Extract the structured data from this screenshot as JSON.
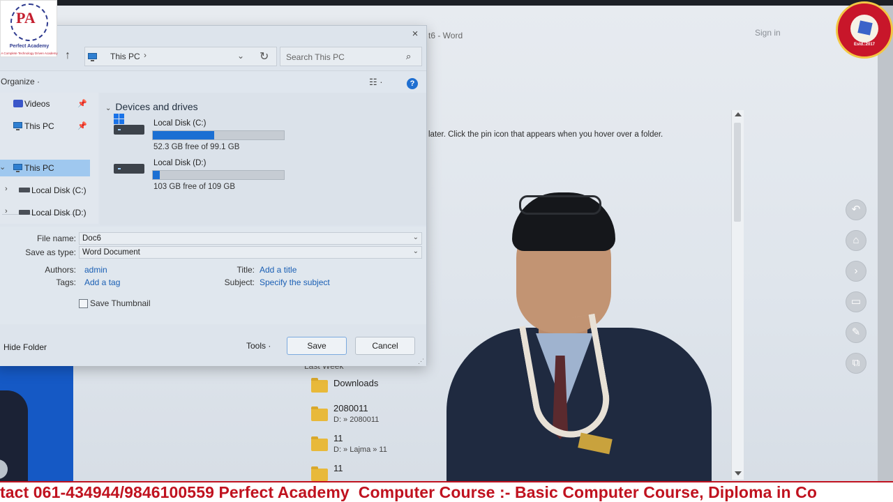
{
  "word": {
    "window_title": "t6 - Word",
    "signin": "Sign in",
    "hint": "later. Click the pin icon that appears when you hover over a folder.",
    "recent_header": "Last Week",
    "recent_items": [
      {
        "name": "Downloads",
        "path": ""
      },
      {
        "name": "2080011",
        "path": "D: » 2080011"
      },
      {
        "name": "11",
        "path": "D: » Lajma » 11"
      },
      {
        "name": "11",
        "path": ""
      }
    ]
  },
  "dialog": {
    "close_glyph": "×",
    "address": {
      "location": "This PC",
      "separator": "›",
      "dropdown_glyph": "⌄",
      "refresh_glyph": "↻",
      "up_glyph": "↑"
    },
    "search_placeholder": "Search This PC",
    "search_glyph": "⌕",
    "organize": "Organize ·",
    "view_glyph": "☷ ·",
    "help_glyph": "?",
    "nav": {
      "quick": [
        {
          "label": "Videos",
          "pin": "📌"
        },
        {
          "label": "This PC",
          "pin": "📌"
        }
      ],
      "tree": [
        {
          "label": "This PC",
          "chevron": "⌄"
        },
        {
          "label": "Local Disk (C:)",
          "chevron": "›"
        },
        {
          "label": "Local Disk (D:)",
          "chevron": "›"
        }
      ]
    },
    "section_title": "Devices and drives",
    "section_chevron": "⌄",
    "drives": [
      {
        "name": "Local Disk (C:)",
        "free_text": "52.3 GB free of 99.1 GB",
        "used_fraction": 0.47
      },
      {
        "name": "Local Disk (D:)",
        "free_text": "103 GB free of 109 GB",
        "used_fraction": 0.055
      }
    ],
    "fields": {
      "file_name_label": "File name:",
      "file_name_value": "Doc6",
      "save_type_label": "Save as type:",
      "save_type_value": "Word Document",
      "dropdown_glyph": "⌄",
      "authors_label": "Authors:",
      "authors_value": "admin",
      "tags_label": "Tags:",
      "tags_value": "Add a tag",
      "title_label": "Title:",
      "title_value": "Add a title",
      "subject_label": "Subject:",
      "subject_value": "Specify the subject",
      "save_thumbnail": "Save Thumbnail"
    },
    "footer": {
      "hide_folder": "Hide Folder",
      "tools": "Tools  ·",
      "save": "Save",
      "cancel": "Cancel"
    }
  },
  "side_tools": [
    {
      "icon": "back-icon",
      "glyph": "↶"
    },
    {
      "icon": "home-icon",
      "glyph": "⌂"
    },
    {
      "icon": "forward-icon",
      "glyph": "›"
    },
    {
      "icon": "briefcase-icon",
      "glyph": "▭"
    },
    {
      "icon": "pen-icon",
      "glyph": "✎"
    },
    {
      "icon": "windows-icon",
      "glyph": "⧉"
    }
  ],
  "logos": {
    "academy_letters": "PA",
    "academy_name": "Perfect Academy",
    "academy_tagline": "A Complete Technology Driven Academy",
    "printing_est": "Estd.:2017"
  },
  "ticker": "tact 061-434944/9846100559 Perfect Academy  Computer Course :- Basic Computer Course, Diploma in Co",
  "colors": {
    "accent": "#1b6fd3",
    "ticker": "#c0121f",
    "selection": "#9fc8ef"
  }
}
